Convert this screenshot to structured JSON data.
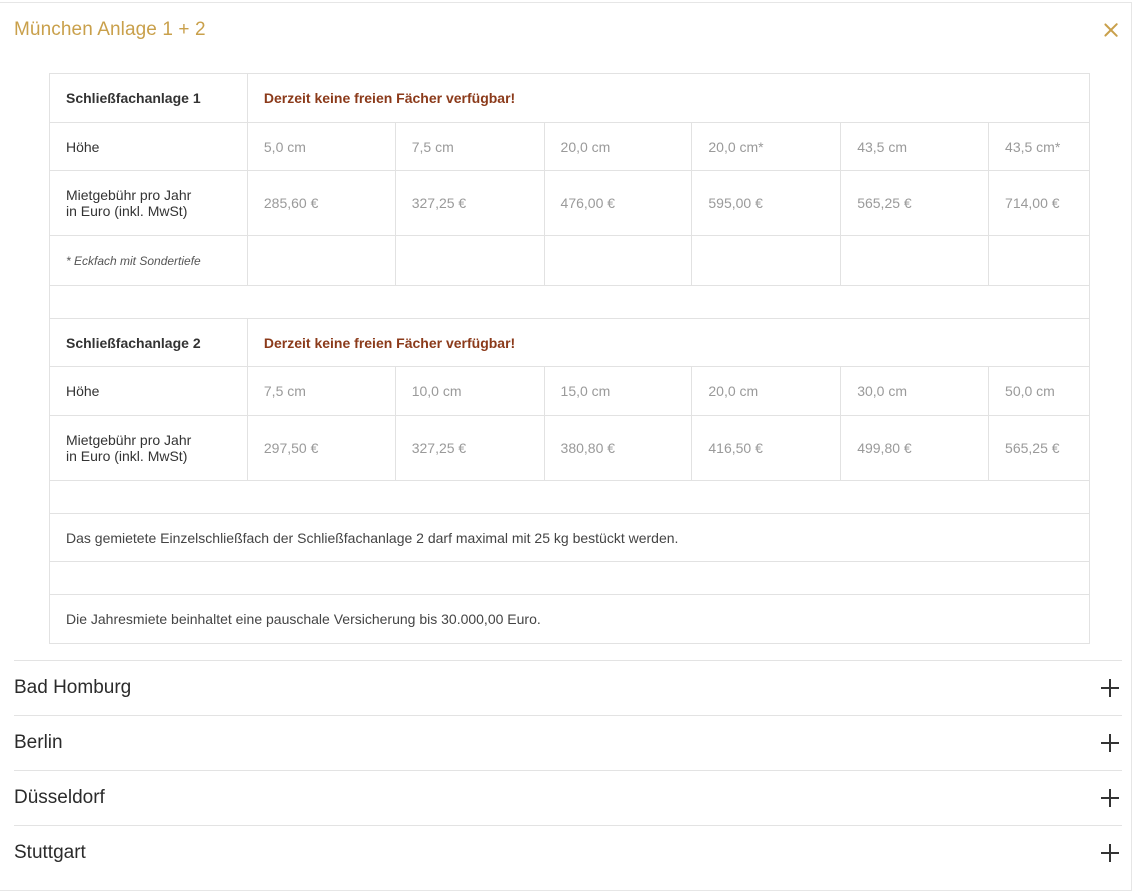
{
  "open_section": {
    "title": "München Anlage 1 + 2",
    "close_icon": "close-icon"
  },
  "anlage1": {
    "name": "Schließfachanlage 1",
    "status": "Derzeit keine freien Fächer verfügbar!",
    "height_label": "Höhe",
    "heights": [
      "5,0 cm",
      "7,5 cm",
      "20,0 cm",
      "20,0 cm*",
      "43,5 cm",
      "43,5 cm*"
    ],
    "fee_label_line1": "Mietgebühr pro Jahr",
    "fee_label_line2": "in Euro (inkl. MwSt)",
    "fees": [
      "285,60 €",
      "327,25 €",
      "476,00 €",
      "595,00 €",
      "565,25 €",
      "714,00 €"
    ],
    "footnote": "* Eckfach mit Sondertiefe"
  },
  "anlage2": {
    "name": "Schließfachanlage 2",
    "status": "Derzeit keine freien Fächer verfügbar!",
    "height_label": "Höhe",
    "heights": [
      "7,5 cm",
      "10,0 cm",
      "15,0 cm",
      "20,0 cm",
      "30,0 cm",
      "50,0 cm"
    ],
    "fee_label_line1": "Mietgebühr pro Jahr",
    "fee_label_line2": "in Euro (inkl. MwSt)",
    "fees": [
      "297,50 €",
      "327,25 €",
      "380,80 €",
      "416,50 €",
      "499,80 €",
      "565,25 €"
    ]
  },
  "notes": {
    "weight": "Das gemietete Einzelschließfach der Schließfachanlage 2 darf maximal mit 25 kg bestückt werden.",
    "insurance": "Die Jahresmiete beinhaltet eine pauschale Versicherung bis 30.000,00 Euro."
  },
  "collapsed_sections": [
    {
      "title": "Bad Homburg",
      "icon": "plus-icon"
    },
    {
      "title": "Berlin",
      "icon": "plus-icon"
    },
    {
      "title": "Düsseldorf",
      "icon": "plus-icon"
    },
    {
      "title": "Stuttgart",
      "icon": "plus-icon"
    }
  ],
  "colors": {
    "accent_gold": "#c9a04b",
    "warning_text": "#8b3a1a",
    "value_grey": "#9a9a9a",
    "border": "#e2e2e2"
  }
}
